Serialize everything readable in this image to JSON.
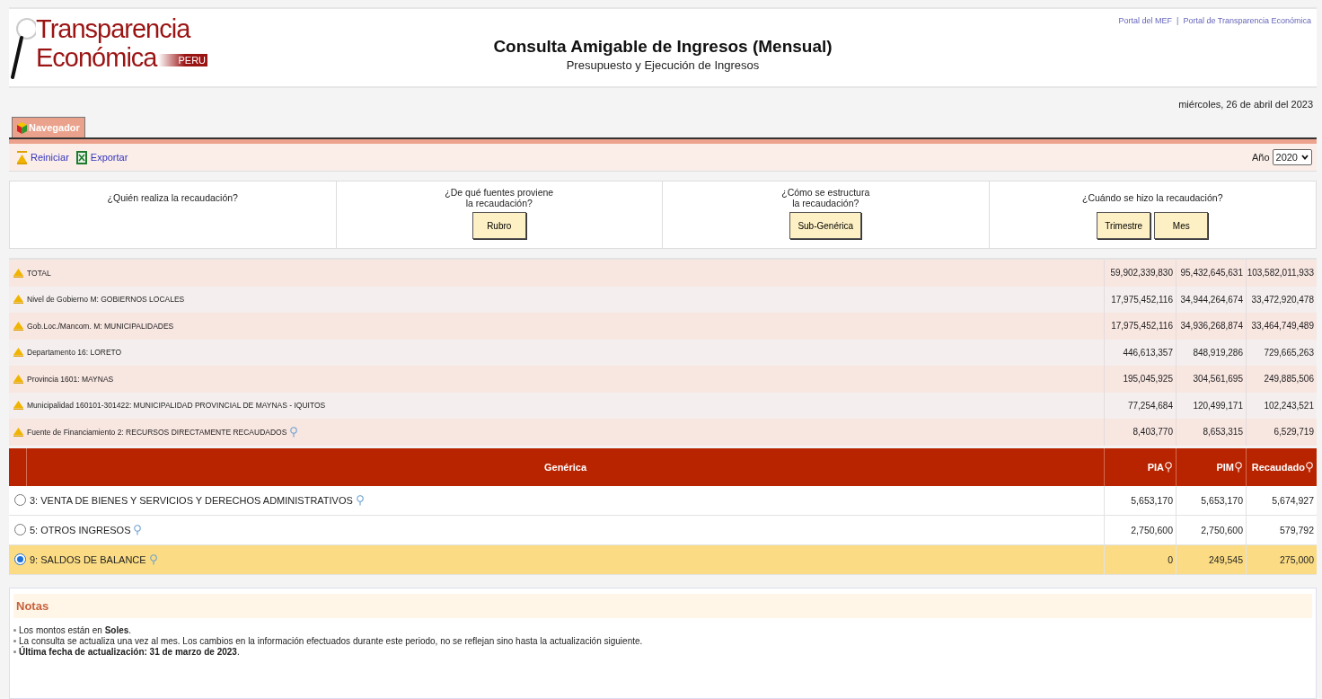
{
  "header": {
    "logo": {
      "line1": "Transparencia",
      "line2": "Económica",
      "badge": "PERU"
    },
    "title": "Consulta Amigable de Ingresos (Mensual)",
    "subtitle": "Presupuesto y Ejecución de Ingresos",
    "links": [
      "Portal del MEF",
      "Portal de Transparencia Económica"
    ],
    "separator": "|"
  },
  "date": "miércoles, 26 de abril del 2023",
  "tabs": [
    {
      "label": "Navegador",
      "selected": true
    }
  ],
  "toolbar": {
    "actions": [
      {
        "label": "Reiniciar",
        "kind": "reset"
      },
      {
        "label": "Exportar",
        "kind": "excel"
      }
    ],
    "year": {
      "label": "Año",
      "value": "2020"
    }
  },
  "questions": [
    {
      "lines": [
        "¿Quién realiza la recaudación?"
      ]
    },
    {
      "lines": [
        "¿De qué fuentes proviene",
        "la recaudación?"
      ],
      "buttons": [
        "Rubro"
      ]
    },
    {
      "lines": [
        "¿Cómo se estructura",
        "la recaudación?"
      ],
      "buttons": [
        "Sub-Genérica"
      ]
    },
    {
      "lines": [
        "¿Cuándo se hizo la recaudación?"
      ],
      "buttons": [
        "Trimestre",
        "Mes"
      ]
    }
  ],
  "summary_rows": [
    {
      "label": "TOTAL",
      "values": [
        "59,902,339,830",
        "95,432,645,631",
        "103,582,011,933"
      ],
      "info": false
    },
    {
      "label": "Nivel de Gobierno M: GOBIERNOS LOCALES",
      "values": [
        "17,975,452,116",
        "34,944,264,674",
        "33,472,920,478"
      ],
      "info": false
    },
    {
      "label": "Gob.Loc./Mancom. M: MUNICIPALIDADES",
      "values": [
        "17,975,452,116",
        "34,936,268,874",
        "33,464,749,489"
      ],
      "info": false
    },
    {
      "label": "Departamento 16: LORETO",
      "values": [
        "446,613,357",
        "848,919,286",
        "729,665,263"
      ],
      "info": false
    },
    {
      "label": "Provincia 1601: MAYNAS",
      "values": [
        "195,045,925",
        "304,561,695",
        "249,885,506"
      ],
      "info": false
    },
    {
      "label": "Municipalidad 160101-301422: MUNICIPALIDAD PROVINCIAL DE MAYNAS - IQUITOS",
      "values": [
        "77,254,684",
        "120,499,171",
        "102,243,521"
      ],
      "info": false
    },
    {
      "label": "Fuente de Financiamiento 2: RECURSOS DIRECTAMENTE RECAUDADOS",
      "values": [
        "8,403,770",
        "8,653,315",
        "6,529,719"
      ],
      "info": true
    }
  ],
  "table": {
    "columns": [
      {
        "label": "Genérica",
        "info": false
      },
      {
        "label": "PIA",
        "info": true
      },
      {
        "label": "PIM",
        "info": true
      },
      {
        "label": "Recaudado",
        "info": true
      }
    ],
    "rows": [
      {
        "label": "3: VENTA DE BIENES Y SERVICIOS Y DERECHOS ADMINISTRATIVOS",
        "values": [
          "5,653,170",
          "5,653,170",
          "5,674,927"
        ],
        "selected": false
      },
      {
        "label": "5: OTROS INGRESOS",
        "values": [
          "2,750,600",
          "2,750,600",
          "579,792"
        ],
        "selected": false
      },
      {
        "label": "9: SALDOS DE BALANCE",
        "values": [
          "0",
          "249,545",
          "275,000"
        ],
        "selected": true
      }
    ]
  },
  "notes": {
    "title": "Notas",
    "items": [
      "Los montos están en **Soles**.",
      "La consulta se actualiza una vez al mes. Los cambios en la información efectuados durante este periodo, no se reflejan sino hasta la actualización siguiente.",
      "**Última fecha de actualización: 31 de marzo de 2023**."
    ]
  }
}
